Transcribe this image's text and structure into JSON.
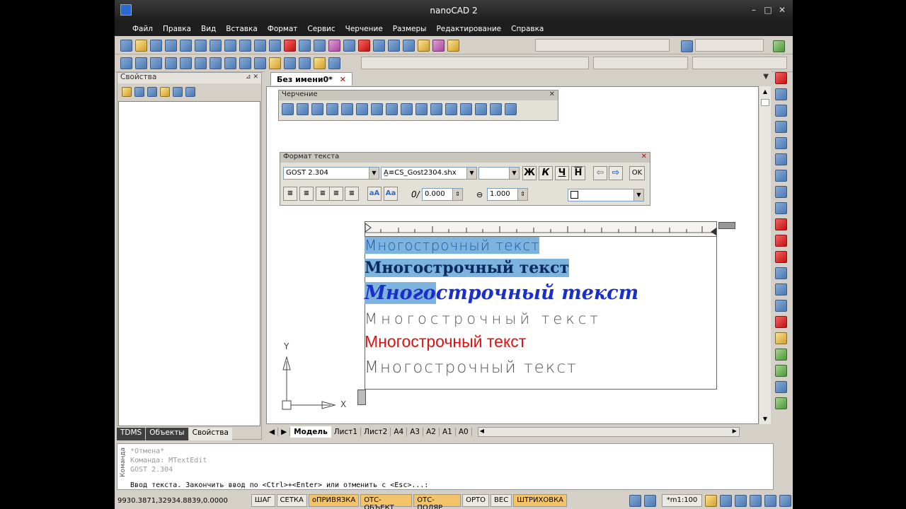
{
  "window": {
    "title": "nanoCAD 2"
  },
  "menu": [
    "Файл",
    "Правка",
    "Вид",
    "Вставка",
    "Формат",
    "Сервис",
    "Черчение",
    "Размеры",
    "Редактирование",
    "Справка"
  ],
  "properties_panel": {
    "title": "Свойства",
    "pin": "⊿ ✕"
  },
  "left_tabs": [
    {
      "label": "TDMS"
    },
    {
      "label": "Объекты"
    },
    {
      "label": "Свойства",
      "active": true
    }
  ],
  "document": {
    "tab_title": "Без имени0*"
  },
  "drawing_toolbar": {
    "title": "Черчение"
  },
  "text_format": {
    "title": "Формат текста",
    "style": "GOST 2.304",
    "font": "CS_Gost2304.shx",
    "bold": "Ж",
    "italic": "К",
    "underline": "Ч",
    "overline": "Н",
    "ok": "OK",
    "case_upper": "aA",
    "case_mixed": "Aa",
    "oblique_symbol": "0/",
    "oblique": "0.000",
    "width_factor": "1.000"
  },
  "mtext_lines": [
    {
      "text": "Многострочный текст"
    },
    {
      "text": "Многострочный текст"
    },
    {
      "text_a": "Много",
      "text_b": "строчный текст"
    },
    {
      "text": "Многострочный текст"
    },
    {
      "text": "Многострочный текст"
    },
    {
      "text": "Многострочный текст"
    }
  ],
  "ucs": {
    "y": "Y",
    "x": "X"
  },
  "layout_tabs": [
    {
      "label": "Модель",
      "active": true
    },
    {
      "label": "Лист1"
    },
    {
      "label": "Лист2"
    },
    {
      "label": "A4"
    },
    {
      "label": "A3"
    },
    {
      "label": "A2"
    },
    {
      "label": "A1"
    },
    {
      "label": "A0"
    }
  ],
  "command": {
    "label": "Команда",
    "history": [
      "*Отмена*",
      "Команда: MTextEdit",
      "GOST 2.304"
    ],
    "prompt": "Ввод текста. Закончить ввод по <Ctrl>+<Enter> или отменить с <Esc>...:"
  },
  "status": {
    "coords": "9930.3871,32934.8839,0.0000",
    "toggles": [
      {
        "label": "ШАГ",
        "on": false
      },
      {
        "label": "СЕТКА",
        "on": false
      },
      {
        "label": "оПРИВЯЗКА",
        "on": true
      },
      {
        "label": "ОТС-ОБЪЕКТ",
        "on": true
      },
      {
        "label": "ОТС-ПОЛЯР",
        "on": true
      },
      {
        "label": "ОРТО",
        "on": false
      },
      {
        "label": "ВЕС",
        "on": false
      },
      {
        "label": "ШТРИХОВКА",
        "on": true
      }
    ],
    "scale": "*m1:100"
  }
}
